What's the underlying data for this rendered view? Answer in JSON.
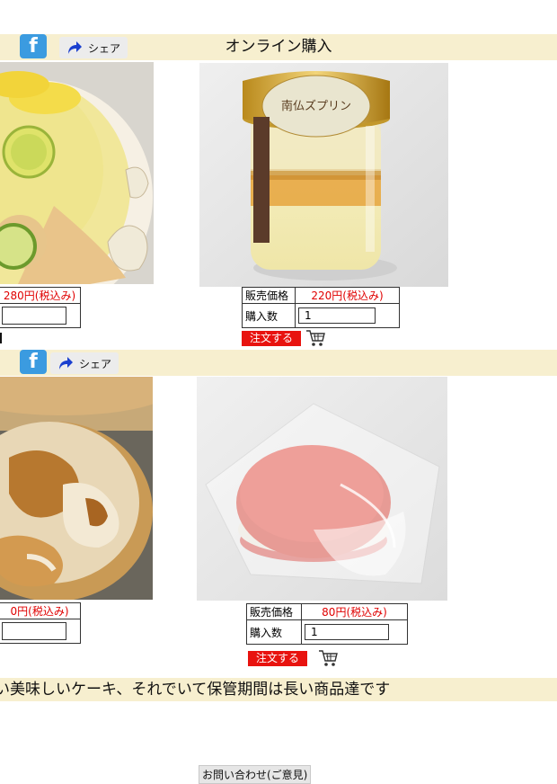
{
  "header": {
    "section_title": "オンライン購入",
    "share_label": "シェア",
    "facebook_label": "f"
  },
  "products": [
    {
      "price_label": "販売価格",
      "price_value": "220円(税込み)",
      "qty_label": "購入数",
      "qty_value": "1",
      "order_label": "注文する",
      "label_text": "南仏ズプリン"
    },
    {
      "price_label": "販売価格",
      "price_value": "80円(税込み)",
      "qty_label": "購入数",
      "qty_value": "1",
      "order_label": "注文する"
    }
  ],
  "partial_left": {
    "price_value_1": "280円(税込み)",
    "price_value_2": "0円(税込み)"
  },
  "bottom_band": {
    "text": "い美味しいケーキ、それでいて保管期間は長い商品達です"
  },
  "contact": {
    "label": "お問い合わせ(ご意見)"
  },
  "colors": {
    "band": "#f7efcf",
    "price_red": "#e00000",
    "order_red": "#e8130f",
    "facebook_blue": "#3b9be0"
  }
}
